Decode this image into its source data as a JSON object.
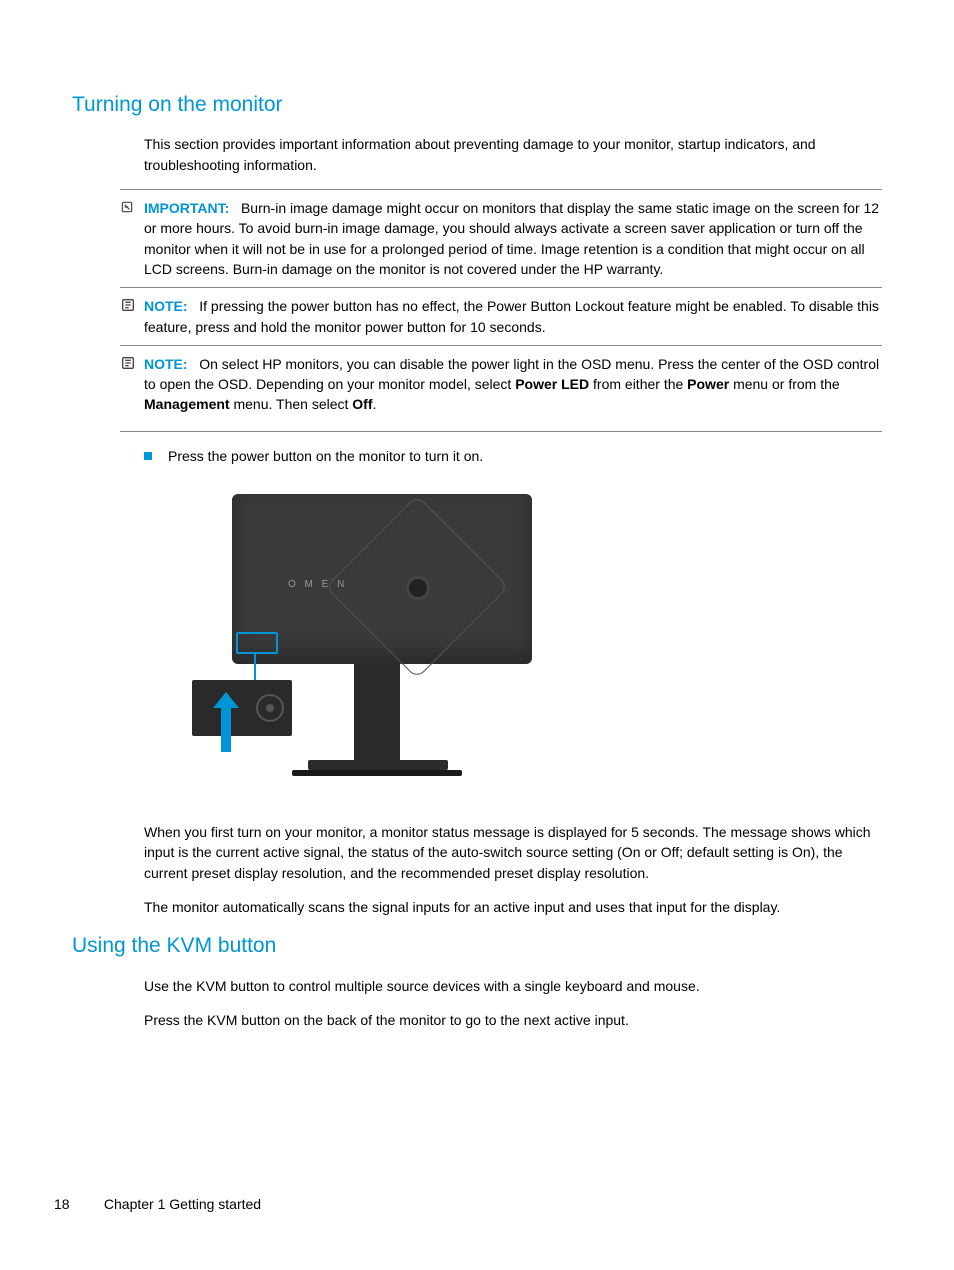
{
  "section1": {
    "heading": "Turning on the monitor",
    "intro": "This section provides important information about preventing damage to your monitor, startup indicators, and troubleshooting information.",
    "important": {
      "label": "IMPORTANT:",
      "text": "Burn-in image damage might occur on monitors that display the same static image on the screen for 12 or more hours. To avoid burn-in image damage, you should always activate a screen saver application or turn off the monitor when it will not be in use for a prolonged period of time. Image retention is a condition that might occur on all LCD screens. Burn-in damage on the monitor is not covered under the HP warranty."
    },
    "note1": {
      "label": "NOTE:",
      "text": "If pressing the power button has no effect, the Power Button Lockout feature might be enabled. To disable this feature, press and hold the monitor power button for 10 seconds."
    },
    "note2": {
      "label": "NOTE:",
      "text_a": "On select HP monitors, you can disable the power light in the OSD menu. Press the center of the OSD control to open the OSD. Depending on your monitor model, select ",
      "bold1": "Power LED",
      "text_b": " from either the ",
      "bold2": "Power",
      "text_c": " menu or from the ",
      "bold3": "Management",
      "text_d": " menu. Then select ",
      "bold4": "Off",
      "text_e": "."
    },
    "bullet1": "Press the power button on the monitor to turn it on.",
    "omen_label": "O M E N",
    "para_after_fig": "When you first turn on your monitor, a monitor status message is displayed for 5 seconds. The message shows which input is the current active signal, the status of the auto-switch source setting (On or Off; default setting is On), the current preset display resolution, and the recommended preset display resolution.",
    "para_scan": "The monitor automatically scans the signal inputs for an active input and uses that input for the display."
  },
  "section2": {
    "heading": "Using the KVM button",
    "para1": "Use the KVM button to control multiple source devices with a single keyboard and mouse.",
    "para2": "Press the KVM button on the back of the monitor to go to the next active input."
  },
  "footer": {
    "page": "18",
    "chapter": "Chapter 1  Getting started"
  }
}
